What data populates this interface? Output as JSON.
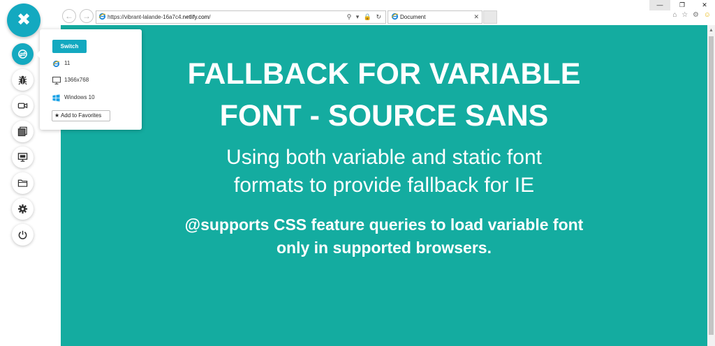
{
  "browser": {
    "back_glyph": "←",
    "forward_glyph": "→",
    "url_prefix": "https://vibrant-lalande-16a7c4.",
    "url_domain": "netlify.com",
    "url_suffix": "/",
    "address_tools": "⚲ ▾ 🔒 ↻",
    "tab_title": "Document",
    "tab_close": "✕",
    "win_min": "—",
    "win_max": "❐",
    "win_close": "✕",
    "toolbar_icons": "⌂ ☆ ⚙",
    "smiley": "☺"
  },
  "page": {
    "title_line1": "FALLBACK FOR VARIABLE",
    "title_line2": "FONT - SOURCE SANS",
    "subtitle_line1": "Using both variable and static font",
    "subtitle_line2": "formats to provide fallback for IE",
    "note_line1": "@supports CSS feature queries to load variable font",
    "note_line2": "only in supported browsers.",
    "background_color": "#14aca0"
  },
  "sidebar": {
    "close_glyph": "✖",
    "accent_color": "#13a9c0",
    "tools": [
      {
        "icon": "switch-browser-icon",
        "active": true
      },
      {
        "icon": "bug-icon",
        "active": false
      },
      {
        "icon": "video-camera-icon",
        "active": false
      },
      {
        "icon": "screenshot-gallery-icon",
        "active": false
      },
      {
        "icon": "resolution-monitor-icon",
        "active": false
      },
      {
        "icon": "folder-icon",
        "active": false
      },
      {
        "icon": "gear-icon",
        "active": false
      },
      {
        "icon": "power-icon",
        "active": false
      }
    ]
  },
  "popover": {
    "switch_label": "Switch",
    "browser_version": "11",
    "resolution": "1366x768",
    "os": "Windows 10",
    "favorites_star": "★",
    "favorites_label": "Add to Favorites"
  }
}
